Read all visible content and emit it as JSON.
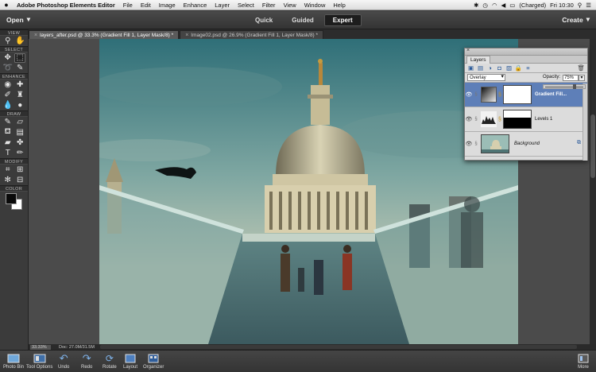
{
  "menubar": {
    "items": [
      "Adobe Photoshop Elements Editor",
      "File",
      "Edit",
      "Image",
      "Enhance",
      "Layer",
      "Select",
      "Filter",
      "View",
      "Window",
      "Help"
    ],
    "battery": "(Charged)",
    "clock": "Fri 10:30"
  },
  "modebar": {
    "open_label": "Open",
    "modes": [
      "Quick",
      "Guided",
      "Expert"
    ],
    "active_mode": "Expert",
    "create_label": "Create"
  },
  "tabs": [
    {
      "label": "layers_after.psd @ 33.3% (Gradient Fill 1, Layer Mask/8) *",
      "active": true
    },
    {
      "label": "Image02.psd @ 26.9% (Gradient Fill 1, Layer Mask/8) *",
      "active": false
    }
  ],
  "toolbox": {
    "sections": {
      "view": "VIEW",
      "select": "SELECT",
      "enhance": "ENHANCE",
      "draw": "DRAW",
      "modify": "MODIFY",
      "color": "COLOR"
    },
    "foreground_color": "#0a0a0a",
    "background_color": "#ffffff"
  },
  "layers_panel": {
    "tab_label": "Layers",
    "blend_mode": "Overlay",
    "opacity_label": "Opacity:",
    "opacity_value": "75%",
    "opacity_fraction": 0.75,
    "layers": [
      {
        "name": "Gradient Fill...",
        "selected": true
      },
      {
        "name": "Levels 1",
        "selected": false
      },
      {
        "name": "Background",
        "selected": false
      }
    ]
  },
  "status": {
    "zoom": "33.33%",
    "doc": "Doc: 27.0M/31.5M"
  },
  "bottom_bar": {
    "left": [
      "Photo Bin",
      "Tool Options",
      "Undo",
      "Redo",
      "Rotate",
      "Layout",
      "Organizer"
    ],
    "right": "More"
  }
}
